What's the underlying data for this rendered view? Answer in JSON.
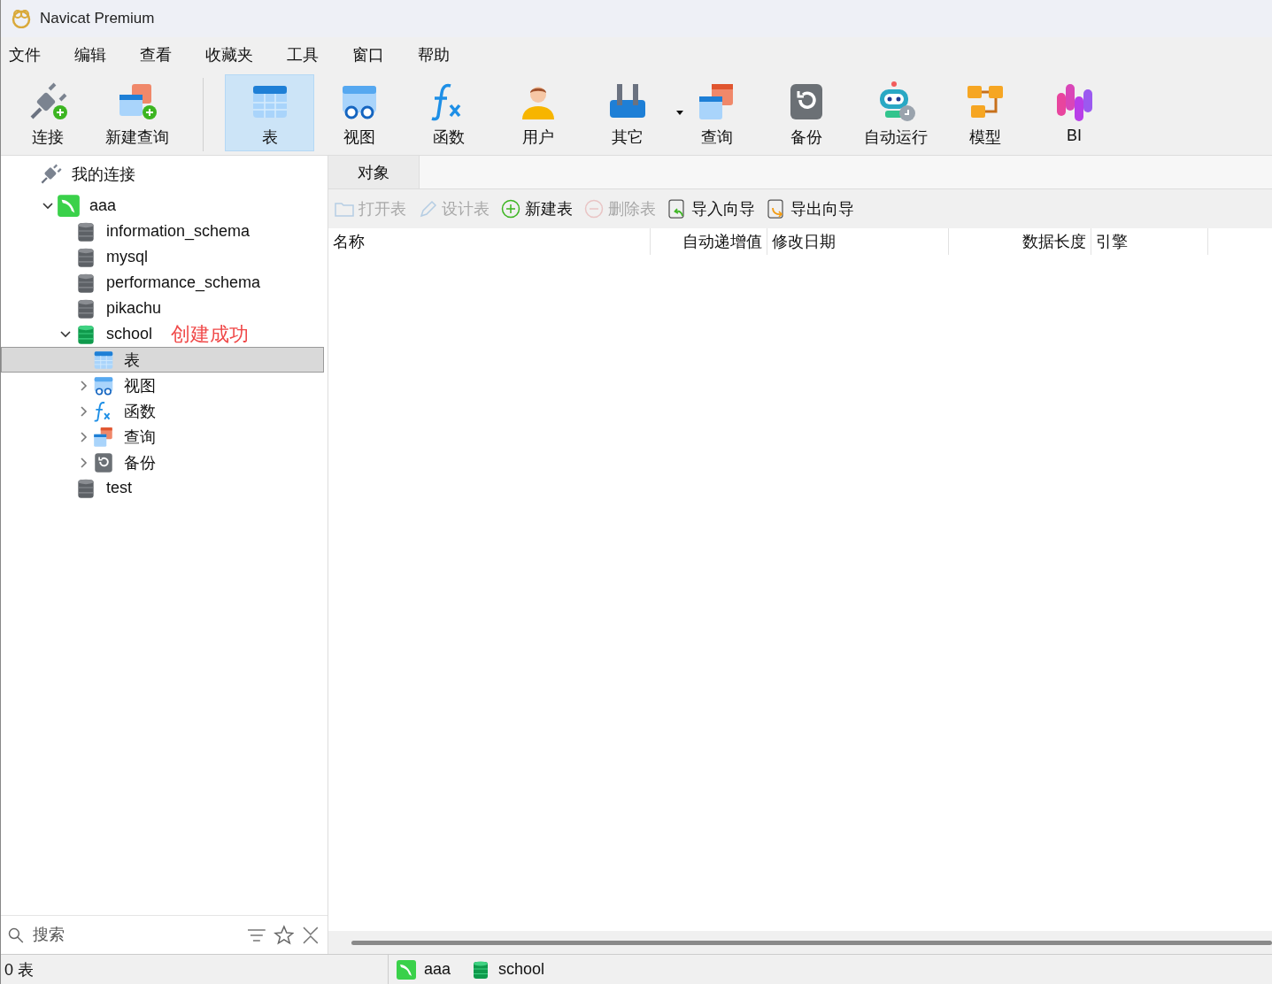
{
  "window": {
    "title": "Navicat Premium"
  },
  "menu": [
    "文件",
    "编辑",
    "查看",
    "收藏夹",
    "工具",
    "窗口",
    "帮助"
  ],
  "toolbar": [
    {
      "label": "连接",
      "kind": "connect",
      "selected": false
    },
    {
      "label": "新建查询",
      "kind": "new_query",
      "selected": false
    },
    {
      "label": "表",
      "kind": "table",
      "selected": true
    },
    {
      "label": "视图",
      "kind": "view",
      "selected": false
    },
    {
      "label": "函数",
      "kind": "function",
      "selected": false
    },
    {
      "label": "用户",
      "kind": "user",
      "selected": false
    },
    {
      "label": "其它",
      "kind": "other",
      "selected": false
    },
    {
      "label": "查询",
      "kind": "query",
      "selected": false
    },
    {
      "label": "备份",
      "kind": "backup",
      "selected": false
    },
    {
      "label": "自动运行",
      "kind": "autorun",
      "selected": false
    },
    {
      "label": "模型",
      "kind": "model",
      "selected": false
    },
    {
      "label": "BI",
      "kind": "bi",
      "selected": false
    }
  ],
  "sidebar": {
    "tree": [
      {
        "label": "我的连接",
        "kind": "group",
        "selected": false,
        "children": [
          {
            "label": "aaa",
            "kind": "connection",
            "expanded": true,
            "selected": false,
            "children": [
              {
                "label": "information_schema",
                "kind": "database",
                "selected": false
              },
              {
                "label": "mysql",
                "kind": "database",
                "selected": false
              },
              {
                "label": "performance_schema",
                "kind": "database",
                "selected": false
              },
              {
                "label": "pikachu",
                "kind": "database",
                "selected": false
              },
              {
                "label": "school",
                "kind": "database_open",
                "expanded": true,
                "selected": false,
                "children": [
                  {
                    "label": "表",
                    "kind": "table",
                    "selected": true
                  },
                  {
                    "label": "视图",
                    "kind": "view",
                    "expanded": false,
                    "selected": false
                  },
                  {
                    "label": "函数",
                    "kind": "function",
                    "expanded": false,
                    "selected": false
                  },
                  {
                    "label": "查询",
                    "kind": "query",
                    "expanded": false,
                    "selected": false
                  },
                  {
                    "label": "备份",
                    "kind": "backup",
                    "expanded": false,
                    "selected": false
                  }
                ]
              },
              {
                "label": "test",
                "kind": "database",
                "selected": false
              }
            ]
          }
        ]
      }
    ],
    "annotation": "创建成功",
    "search": {
      "placeholder": "搜索"
    }
  },
  "tabs": [
    {
      "label": "对象",
      "selected": true
    }
  ],
  "object_toolbar": [
    {
      "label": "打开表",
      "kind": "open",
      "disabled": true
    },
    {
      "label": "设计表",
      "kind": "design",
      "disabled": true
    },
    {
      "label": "新建表",
      "kind": "new",
      "disabled": false
    },
    {
      "label": "删除表",
      "kind": "delete",
      "disabled": true
    },
    {
      "label": "导入向导",
      "kind": "import",
      "disabled": false
    },
    {
      "label": "导出向导",
      "kind": "export",
      "disabled": false
    }
  ],
  "table": {
    "columns": [
      "名称",
      "自动递增值",
      "修改日期",
      "数据长度",
      "引擎"
    ]
  },
  "status_bar": {
    "count": "0 表",
    "connection": "aaa",
    "database": "school"
  }
}
